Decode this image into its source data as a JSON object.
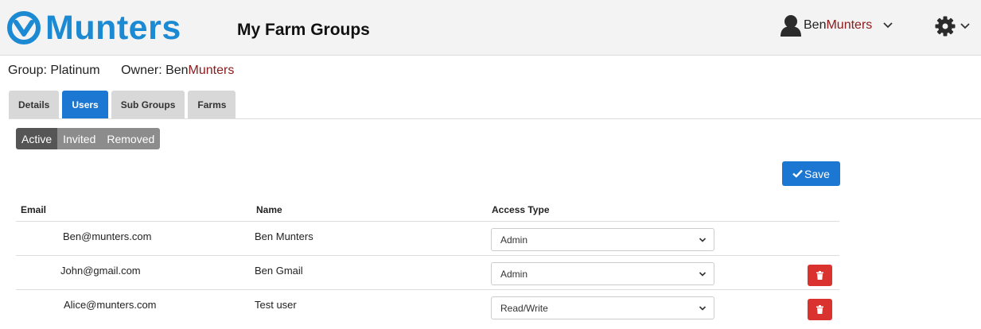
{
  "header": {
    "logo_text": "Munters",
    "page_title": "My Farm Groups",
    "user": {
      "first": "Ben",
      "last": "Munters",
      "avatar_icon": "user-icon",
      "caret_icon": "chevron-down-icon"
    },
    "settings_icon": "gear-icon",
    "brand_color": "#1b8ad3"
  },
  "group_info": {
    "group_label": "Group: Platinum",
    "owner_label": "Owner: ",
    "owner_first": "Ben",
    "owner_last": "Munters"
  },
  "tabs": [
    {
      "label": "Details",
      "active": false
    },
    {
      "label": "Users",
      "active": true
    },
    {
      "label": "Sub Groups",
      "active": false
    },
    {
      "label": "Farms",
      "active": false
    }
  ],
  "filters": [
    {
      "label": "Active",
      "active": true
    },
    {
      "label": "Invited",
      "active": false
    },
    {
      "label": "Removed",
      "active": false
    }
  ],
  "save_button": {
    "label": "Save",
    "icon": "check-icon"
  },
  "table": {
    "headers": {
      "email": "Email",
      "name": "Name",
      "access": "Access Type"
    },
    "rows": [
      {
        "email": "Ben@munters.com",
        "name": "Ben Munters",
        "access": "Admin",
        "deletable": false
      },
      {
        "email": "John@gmail.com",
        "name": "Ben Gmail",
        "access": "Admin",
        "deletable": true
      },
      {
        "email": "Alice@munters.com",
        "name": "Test user",
        "access": "Read/Write",
        "deletable": true
      }
    ],
    "delete_icon": "trash-icon"
  },
  "colors": {
    "primary_blue": "#1b77d2",
    "danger_red": "#d9322f",
    "owner_red": "#8b1a1a"
  }
}
